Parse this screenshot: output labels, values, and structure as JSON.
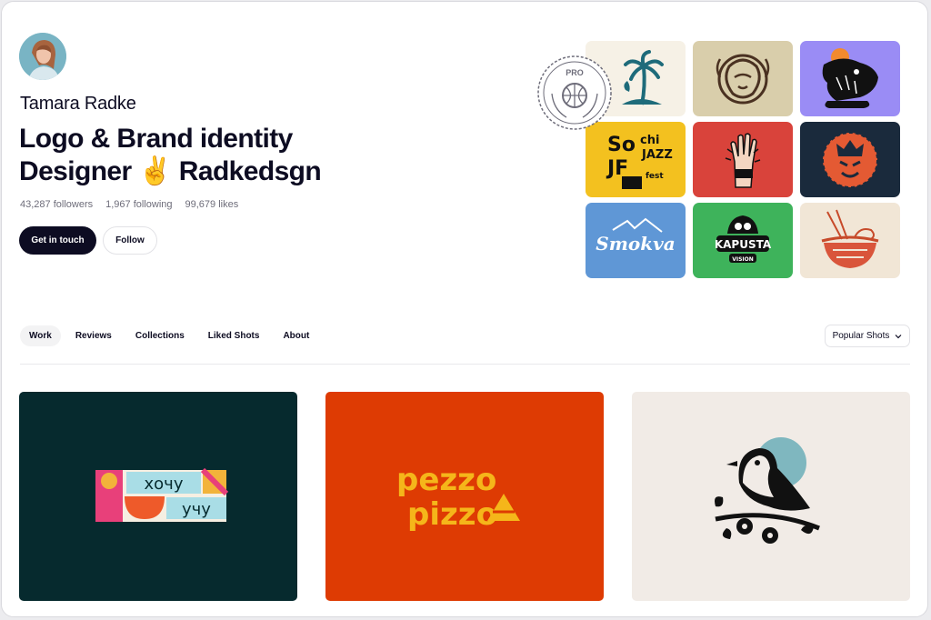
{
  "profile": {
    "name": "Tamara Radke",
    "headline_line1": "Logo & Brand identity",
    "headline_line2": "Designer ✌️ Radkedsgn",
    "followers": "43,287 followers",
    "following": "1,967 following",
    "likes": "99,679 likes"
  },
  "actions": {
    "primary": "Get in touch",
    "follow": "Follow"
  },
  "badge": {
    "label": "PRO"
  },
  "portfolio_tiles": [
    {
      "icon": "palm-island-logo-icon",
      "bg": "#f6f1e6"
    },
    {
      "icon": "ornamental-face-logo-icon",
      "bg": "#d9ceab"
    },
    {
      "icon": "beaver-logo-icon",
      "bg": "#9a8cf5"
    },
    {
      "icon": "sochi-jazz-festival-logo-icon",
      "bg": "#f3c11f"
    },
    {
      "icon": "hand-logo-icon",
      "bg": "#d9433b"
    },
    {
      "icon": "mask-logo-icon",
      "bg": "#1a2a3c"
    },
    {
      "icon": "smokva-logo-icon",
      "bg": "#5f97d6"
    },
    {
      "icon": "kapusta-vision-logo-icon",
      "bg": "#3eb35b"
    },
    {
      "icon": "ramen-bowl-logo-icon",
      "bg": "#f1e6d6"
    }
  ],
  "tabs": [
    {
      "label": "Work",
      "active": true
    },
    {
      "label": "Reviews"
    },
    {
      "label": "Collections"
    },
    {
      "label": "Liked Shots"
    },
    {
      "label": "About"
    }
  ],
  "sort": {
    "label": "Popular Shots"
  },
  "shots": [
    {
      "bg": "#062a2e",
      "text1": "хочу",
      "text2": "учу",
      "icon": "hochu-uchu-logo-icon"
    },
    {
      "bg": "#de3b03",
      "text1": "pezzo",
      "text2": "pizzo",
      "icon": "pezzo-pizzo-logo-icon"
    },
    {
      "bg": "#f1ebe6",
      "icon": "bird-on-branch-logo-icon"
    }
  ],
  "colors": {
    "accent": "#0d0c22",
    "muted": "#6e6d7a"
  }
}
